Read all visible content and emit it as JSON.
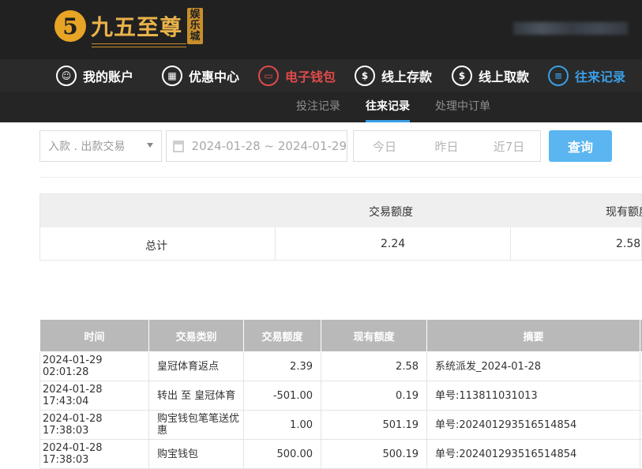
{
  "brand": {
    "logo_glyph": "5",
    "name": "九五至尊",
    "badge_line1": "娱",
    "badge_line2": "乐",
    "badge_line3": "城",
    "accent_color": "#e9b24a"
  },
  "nav": {
    "items": [
      {
        "label": "我的账户",
        "icon": "user-icon"
      },
      {
        "label": "优惠中心",
        "icon": "gift-icon"
      },
      {
        "label": "电子钱包",
        "icon": "wallet-icon"
      },
      {
        "label": "线上存款",
        "icon": "deposit-icon"
      },
      {
        "label": "线上取款",
        "icon": "withdraw-icon"
      },
      {
        "label": "往来记录",
        "icon": "records-icon"
      }
    ]
  },
  "subnav": {
    "items": [
      {
        "label": "投注记录"
      },
      {
        "label": "往来记录"
      },
      {
        "label": "处理中订单"
      }
    ]
  },
  "filters": {
    "type_select": "入款 . 出款交易",
    "date_range": "2024-01-28 ~ 2024-01-29",
    "today": "今日",
    "yesterday": "昨日",
    "last7": "近7日",
    "query_label": "查询",
    "query_color": "#5bb5f0"
  },
  "summary": {
    "headers": [
      "交易额度",
      "现有额度"
    ],
    "row_label": "总计",
    "values": [
      "2.24",
      "2.58"
    ]
  },
  "table": {
    "headers": [
      "时间",
      "交易类别",
      "交易额度",
      "现有额度",
      "摘要"
    ],
    "rows": [
      [
        "2024-01-29 02:01:28",
        "皇冠体育返点",
        "2.39",
        "2.58",
        "系统派发_2024-01-28"
      ],
      [
        "2024-01-28 17:43:04",
        "转出 至 皇冠体育",
        "-501.00",
        "0.19",
        "单号:113811031013"
      ],
      [
        "2024-01-28 17:38:03",
        "购宝钱包笔笔送优惠",
        "1.00",
        "501.19",
        "单号:202401293516514854"
      ],
      [
        "2024-01-28 17:38:03",
        "购宝钱包",
        "500.00",
        "500.19",
        "单号:202401293516514854"
      ]
    ]
  }
}
